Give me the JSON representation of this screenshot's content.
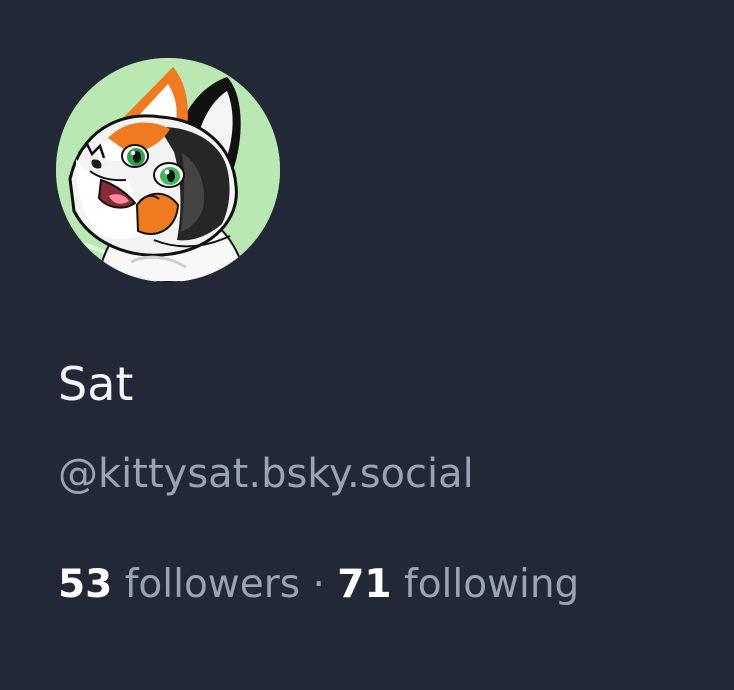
{
  "profile": {
    "display_name": "Sat",
    "handle": "@kittysat.bsky.social",
    "avatar_icon": "calico-cat-avatar",
    "stats": {
      "followers_count": "53",
      "followers_label": "followers",
      "separator": "·",
      "following_count": "71",
      "following_label": "following"
    }
  },
  "colors": {
    "background": "#222836",
    "name": "#f2f4f7",
    "muted": "#99a3b3",
    "avatar_background": "#b9e8b3"
  }
}
